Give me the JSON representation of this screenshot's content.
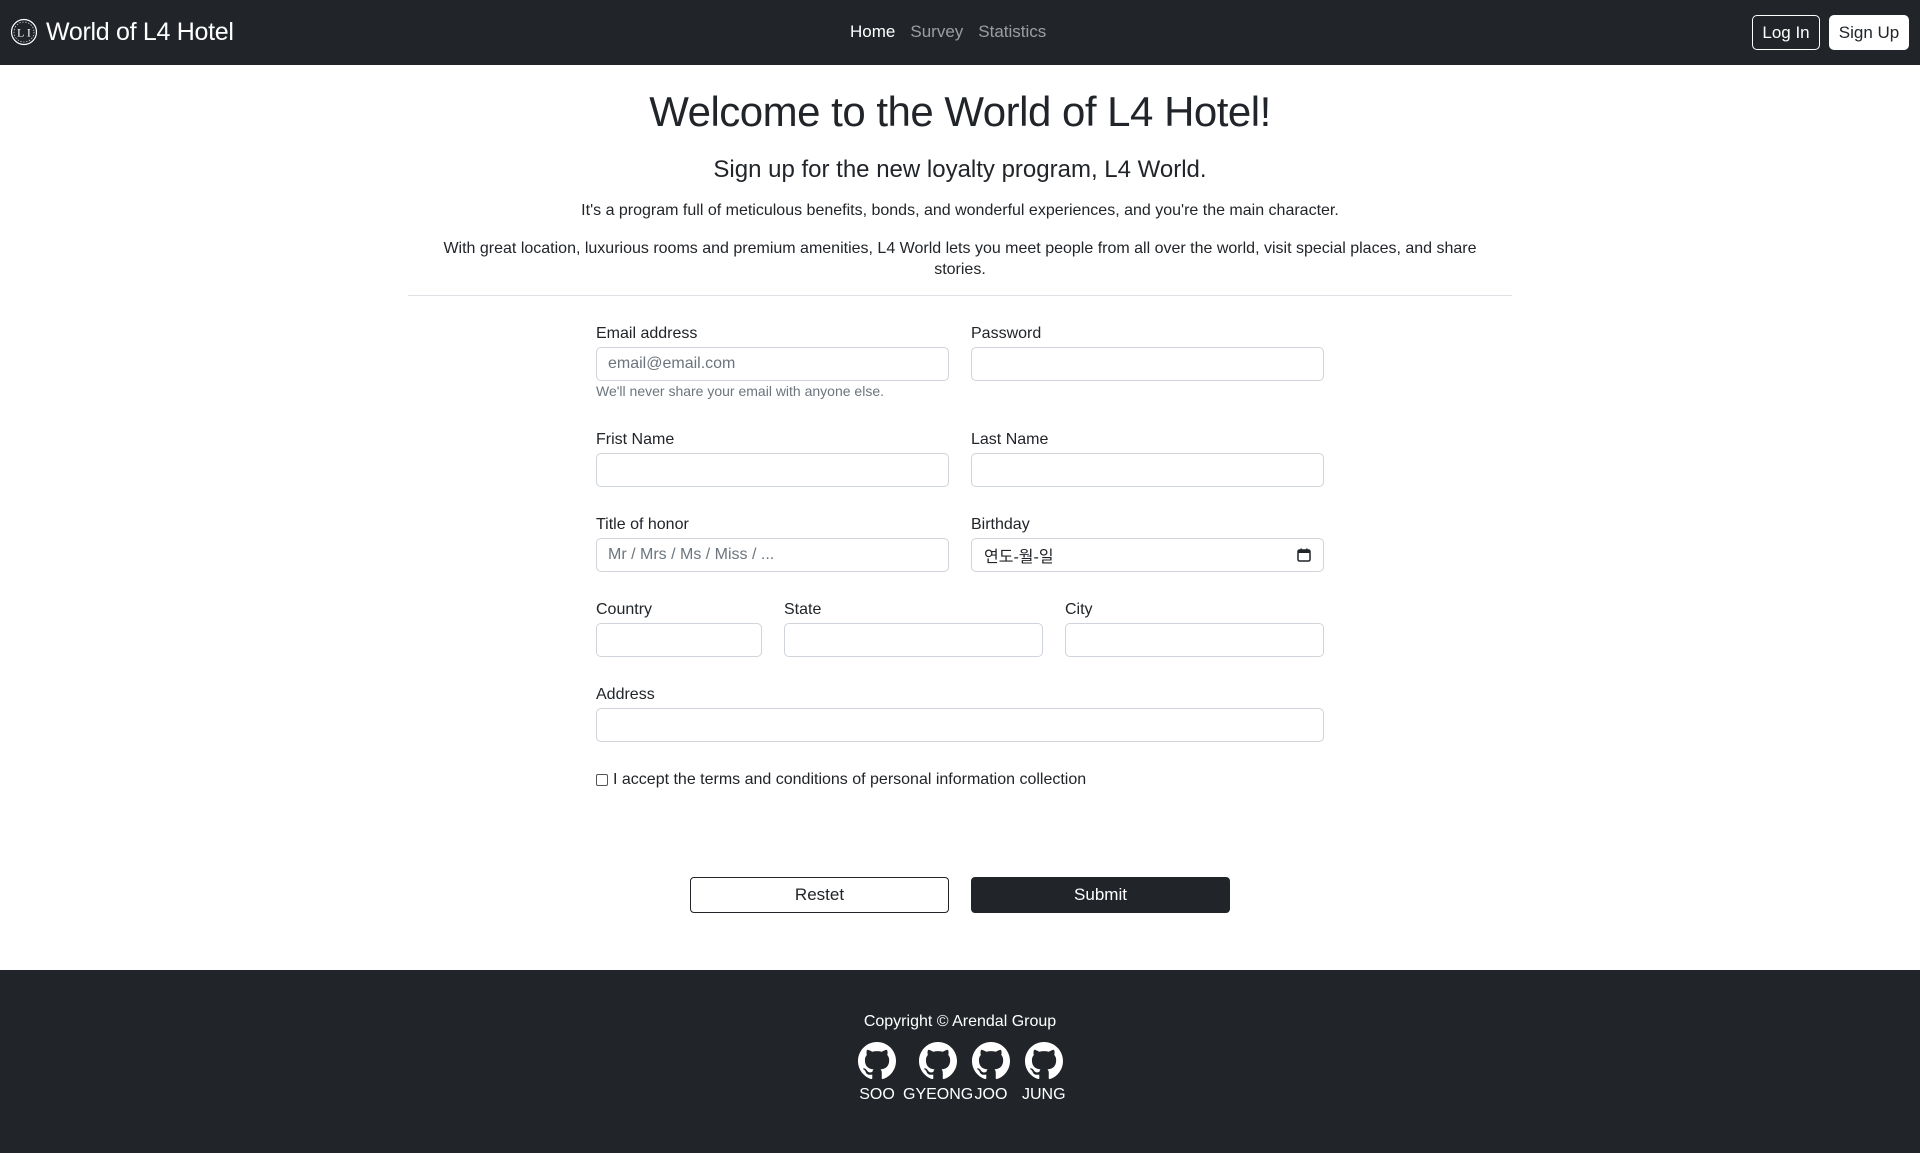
{
  "navbar": {
    "brand": "World of L4 Hotel",
    "links": [
      "Home",
      "Survey",
      "Statistics"
    ],
    "login": "Log In",
    "signup": "Sign Up"
  },
  "hero": {
    "title": "Welcome to the World of L4 Hotel!",
    "subtitle": "Sign up for the new loyalty program, L4 World.",
    "p1": "It's a program full of meticulous benefits, bonds, and wonderful experiences, and you're the main character.",
    "p2": "With great location, luxurious rooms and premium amenities, L4 World lets you meet people from all over the world, visit special places, and share stories."
  },
  "form": {
    "email_label": "Email address",
    "email_placeholder": "email@email.com",
    "email_help": "We'll never share your email with anyone else.",
    "password_label": "Password",
    "first_name_label": "Frist Name",
    "last_name_label": "Last Name",
    "title_label": "Title of honor",
    "title_placeholder": "Mr / Mrs / Ms / Miss / ...",
    "birthday_label": "Birthday",
    "birthday_placeholder": "연도-월-일",
    "country_label": "Country",
    "state_label": "State",
    "city_label": "City",
    "address_label": "Address",
    "terms_label": "I accept the terms and conditions of personal information collection",
    "reset_label": "Restet",
    "submit_label": "Submit"
  },
  "footer": {
    "copyright": "Copyright © Arendal Group",
    "members": [
      "SOO",
      "GYEONG",
      "JOO",
      "JUNG"
    ]
  },
  "colors": {
    "dark": "#212529",
    "border": "#ced4da",
    "muted": "#6c757d"
  },
  "icons": {
    "brand": "l4-logo-icon",
    "birthday": "calendar-icon",
    "footer": "github-icon"
  }
}
